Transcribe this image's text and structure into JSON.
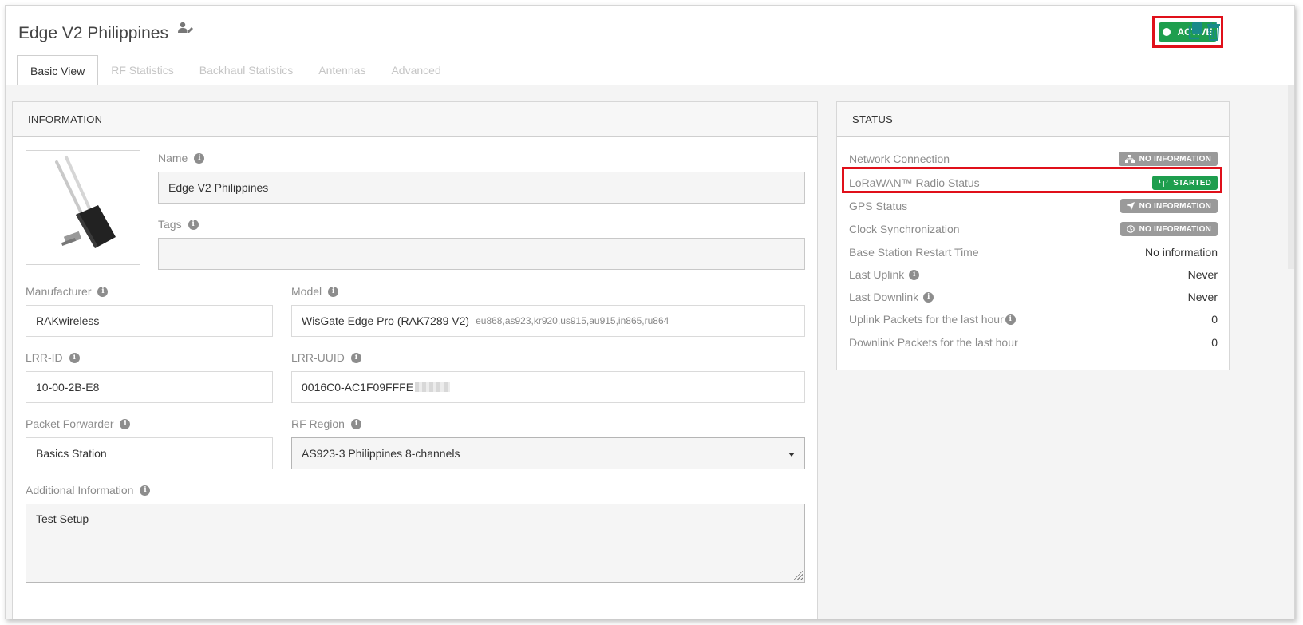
{
  "header": {
    "title": "Edge V2 Philippines",
    "status_badge": "ACTIVE",
    "edit_icon": "user-edit-icon",
    "copy_icon": "copy-icon",
    "delete_icon": "trash-icon"
  },
  "tabs": [
    {
      "label": "Basic View",
      "active": true
    },
    {
      "label": "RF Statistics",
      "active": false
    },
    {
      "label": "Backhaul Statistics",
      "active": false
    },
    {
      "label": "Antennas",
      "active": false
    },
    {
      "label": "Advanced",
      "active": false
    }
  ],
  "information": {
    "heading": "INFORMATION",
    "name_label": "Name",
    "name_value": "Edge V2 Philippines",
    "tags_label": "Tags",
    "tags_value": "",
    "manufacturer_label": "Manufacturer",
    "manufacturer_value": "RAKwireless",
    "model_label": "Model",
    "model_value": "WisGate Edge Pro (RAK7289 V2)",
    "model_bands": "eu868,as923,kr920,us915,au915,in865,ru864",
    "lrr_id_label": "LRR-ID",
    "lrr_id_value": "10-00-2B-E8",
    "lrr_uuid_label": "LRR-UUID",
    "lrr_uuid_value": "0016C0-AC1F09FFFE",
    "packet_forwarder_label": "Packet Forwarder",
    "packet_forwarder_value": "Basics Station",
    "rf_region_label": "RF Region",
    "rf_region_value": "AS923-3 Philippines 8-channels",
    "additional_label": "Additional Information",
    "additional_value": "Test Setup"
  },
  "status": {
    "heading": "STATUS",
    "rows": {
      "network": {
        "label": "Network Connection",
        "value": "NO INFORMATION"
      },
      "radio": {
        "label": "LoRaWAN™ Radio Status",
        "value": "STARTED"
      },
      "gps": {
        "label": "GPS Status",
        "value": "NO INFORMATION"
      },
      "clock": {
        "label": "Clock Synchronization",
        "value": "NO INFORMATION"
      },
      "restart": {
        "label": "Base Station Restart Time",
        "value": "No information"
      },
      "uplink": {
        "label": "Last Uplink",
        "value": "Never"
      },
      "downlink": {
        "label": "Last Downlink",
        "value": "Never"
      },
      "uplink_packets": {
        "label": "Uplink Packets for the last hour",
        "value": "0"
      },
      "downlink_packets": {
        "label": "Downlink Packets for the last hour",
        "value": "0"
      }
    }
  },
  "colors": {
    "active_green": "#1e9e4e",
    "highlight_red": "#e0101a",
    "icon_teal": "#1a8a8a",
    "pill_gray": "#9a9a9a"
  }
}
